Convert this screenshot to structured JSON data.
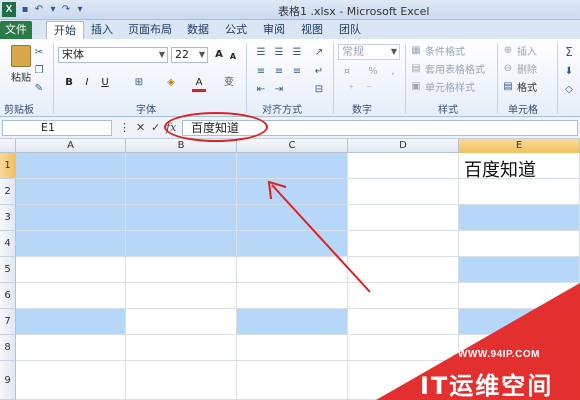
{
  "window": {
    "title": "表格1 .xlsx - Microsoft Excel"
  },
  "tabs": [
    "文件",
    "开始",
    "插入",
    "页面布局",
    "数据",
    "公式",
    "审阅",
    "视图",
    "团队"
  ],
  "ribbon": {
    "clipboard": {
      "paste_label": "粘贴",
      "group_label": "剪贴板"
    },
    "font": {
      "name": "宋体",
      "size": "22",
      "group_label": "字体",
      "grow_label": "A",
      "shrink_label": "A",
      "bold": "B",
      "italic": "I",
      "underline": "U",
      "font_color_label": "A",
      "wen_label": "变"
    },
    "alignment": {
      "group_label": "对齐方式"
    },
    "number": {
      "format": "常规",
      "percent": "%",
      "comma": ",",
      "group_label": "数字"
    },
    "styles": {
      "conditional_label": "条件格式",
      "table_label": "套用表格格式",
      "cell_styles_label": "单元格样式",
      "group_label": "样式"
    },
    "cells": {
      "insert_label": "插入",
      "delete_label": "删除",
      "format_label": "格式",
      "group_label": "单元格"
    },
    "editing": {
      "sum_label": "Σ"
    }
  },
  "formula_bar": {
    "name_box": "E1",
    "fx_label": "fx",
    "cancel_label": "✕",
    "enter_label": "✓",
    "value": "百度知道"
  },
  "grid": {
    "columns": [
      "A",
      "B",
      "C",
      "D",
      "E"
    ],
    "rows": [
      "1",
      "2",
      "3",
      "4",
      "5",
      "6",
      "7",
      "8",
      "9"
    ],
    "e1_value": "百度知道"
  },
  "watermark": {
    "url": "WWW.94IP.COM",
    "name": "IT运维空间"
  },
  "colors": {
    "selection_fill": "#b7d7f9",
    "annotation": "#e02020",
    "file_tab": "#2a7a45",
    "header_selected": "#f1c15f"
  }
}
